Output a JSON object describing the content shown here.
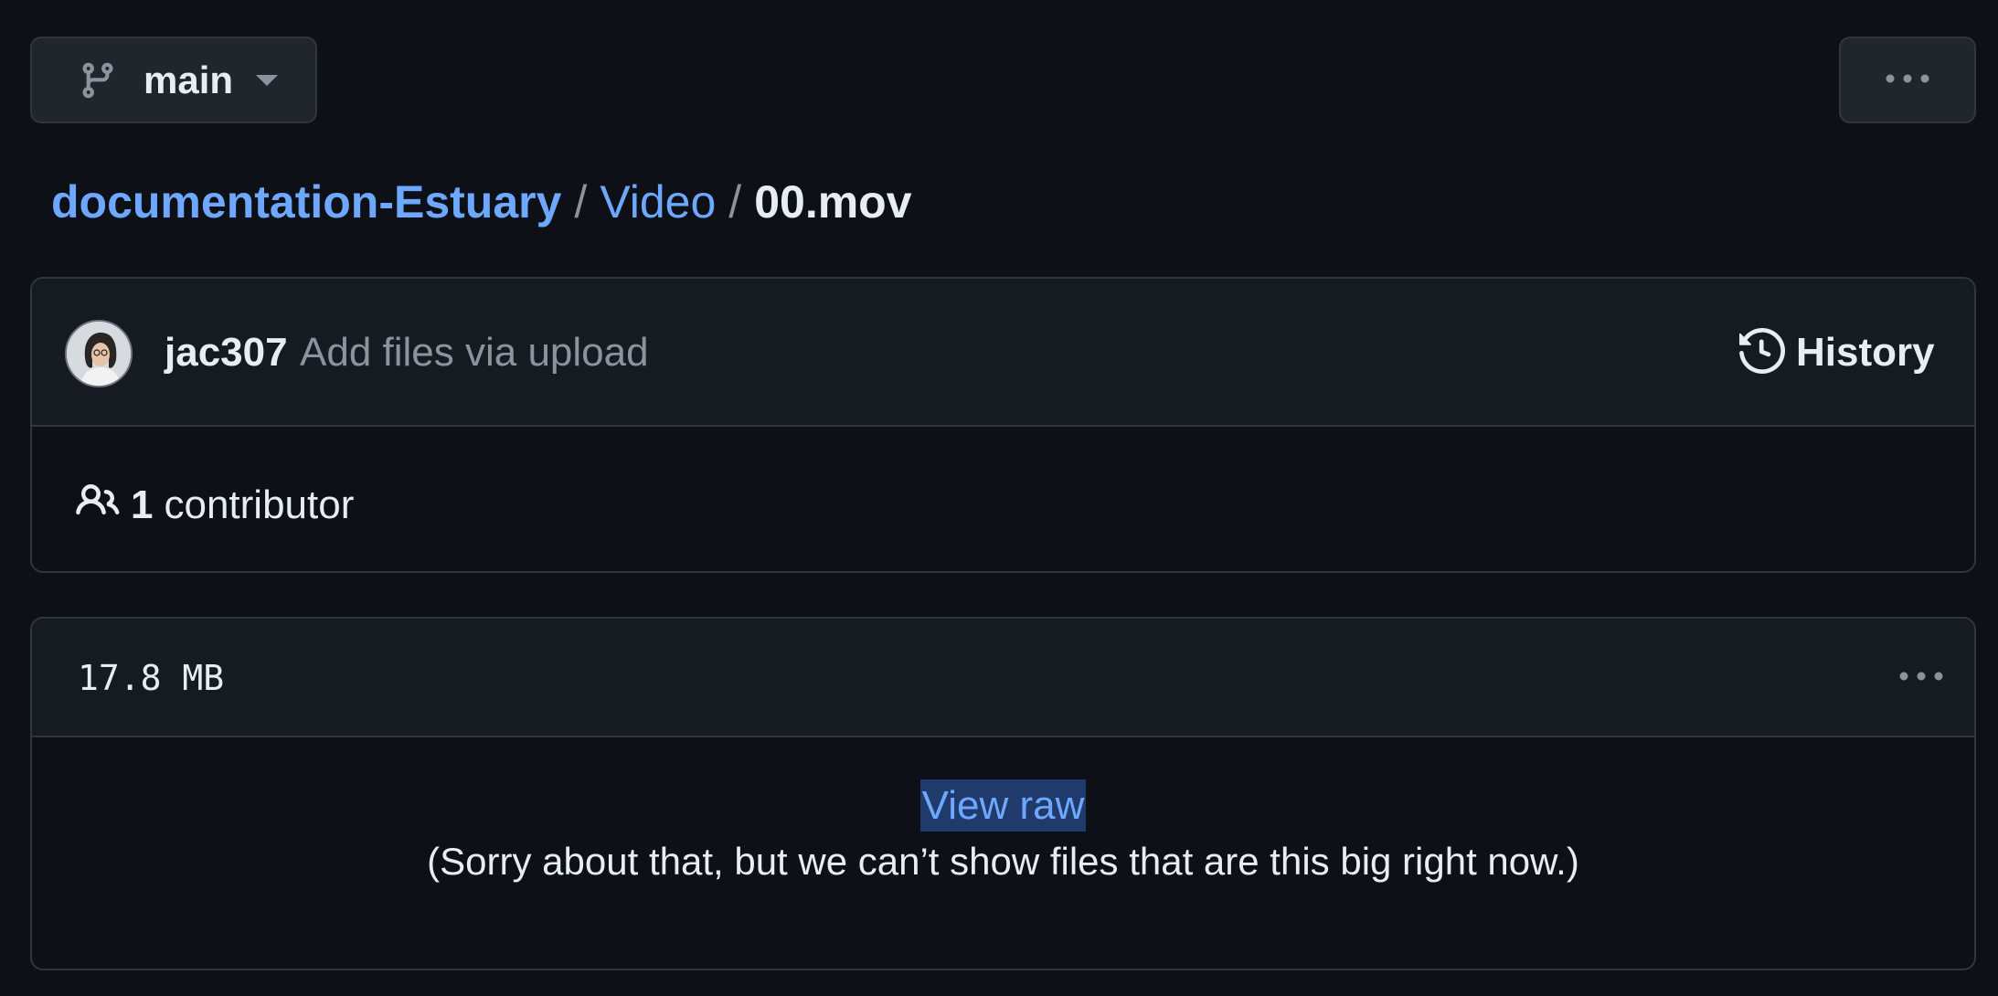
{
  "branch": {
    "label": "main",
    "icon": "git-branch-icon"
  },
  "header_more": {
    "icon": "kebab-horizontal-icon"
  },
  "breadcrumb": {
    "repo": "documentation-Estuary",
    "separator": "/",
    "folder": "Video",
    "file": "00.mov"
  },
  "commit": {
    "author": "jac307",
    "message": "Add files via upload",
    "history_label": "History",
    "history_icon": "history-icon"
  },
  "contributors": {
    "icon": "people-icon",
    "count": "1",
    "label": "contributor"
  },
  "file": {
    "size": "17.8 MB",
    "more_icon": "kebab-horizontal-icon",
    "view_raw_label": "View raw",
    "too_big_message": "(Sorry about that, but we can’t show files that are this big right now.)"
  },
  "colors": {
    "background": "#0d1117",
    "panel": "#161b22",
    "border": "#30363d",
    "link": "#6ea8fe",
    "text": "#e6edf3",
    "muted": "#8b949e"
  }
}
